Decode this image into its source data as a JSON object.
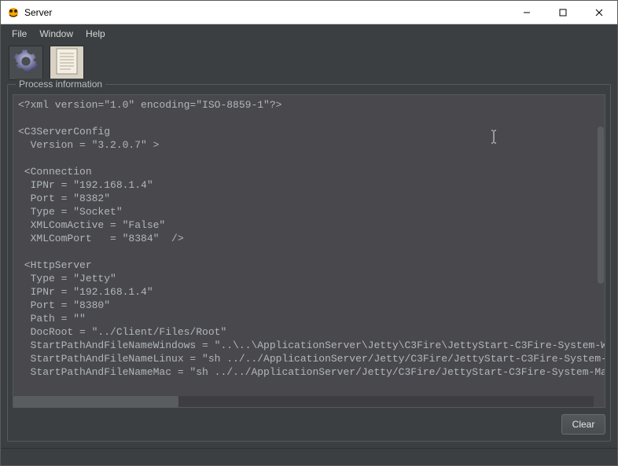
{
  "titlebar": {
    "title": "Server"
  },
  "menubar": {
    "items": [
      "File",
      "Window",
      "Help"
    ]
  },
  "toolbar": {
    "buttons": [
      "settings-gear",
      "document"
    ]
  },
  "group": {
    "title": "Process information"
  },
  "buttons": {
    "clear": "Clear"
  },
  "code_lines": [
    "<?xml version=\"1.0\" encoding=\"ISO-8859-1\"?>",
    "",
    "<C3ServerConfig",
    "  Version = \"3.2.0.7\" >",
    "",
    " <Connection",
    "  IPNr = \"192.168.1.4\"",
    "  Port = \"8382\"",
    "  Type = \"Socket\"",
    "  XMLComActive = \"False\"",
    "  XMLComPort   = \"8384\"  />",
    "",
    " <HttpServer",
    "  Type = \"Jetty\"",
    "  IPNr = \"192.168.1.4\"",
    "  Port = \"8380\"",
    "  Path = \"\"",
    "  DocRoot = \"../Client/Files/Root\"",
    "  StartPathAndFileNameWindows = \"..\\..\\ApplicationServer\\Jetty\\C3Fire\\JettyStart-C3Fire-System-Windows.ba",
    "  StartPathAndFileNameLinux = \"sh ../../ApplicationServer/Jetty/C3Fire/JettyStart-C3Fire-System-Linux.sh\"",
    "  StartPathAndFileNameMac = \"sh ../../ApplicationServer/Jetty/C3Fire/JettyStart-C3Fire-System-Mac.sh\""
  ]
}
